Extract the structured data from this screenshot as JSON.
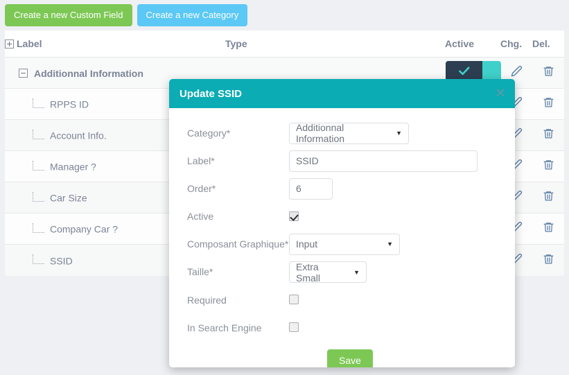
{
  "toolbar": {
    "create_custom_field_label": "Create a new Custom Field",
    "create_category_label": "Create a new Category"
  },
  "table": {
    "columns": {
      "label": "Label",
      "type": "Type",
      "active": "Active",
      "chg": "Chg.",
      "del": "Del."
    },
    "expand_all_icon": "plus-square-icon",
    "category": {
      "name": "Additionnal Information",
      "collapse_icon": "minus-square-icon",
      "active": true
    },
    "rows": [
      {
        "label": "RPPS ID",
        "type": ""
      },
      {
        "label": "Account Info.",
        "type": ""
      },
      {
        "label": "Manager ?",
        "type": ""
      },
      {
        "label": "Car Size",
        "type": ""
      },
      {
        "label": "Company Car ?",
        "type": ""
      },
      {
        "label": "SSID",
        "type": ""
      }
    ],
    "edit_icon": "pencil-icon",
    "delete_icon": "trash-icon"
  },
  "modal": {
    "title": "Update SSID",
    "close_icon": "close-icon",
    "fields": {
      "category_label": "Category*",
      "category_value": "Additionnal Information",
      "label_label": "Label*",
      "label_value": "SSID",
      "order_label": "Order*",
      "order_value": "6",
      "active_label": "Active",
      "active_checked": true,
      "composant_label": "Composant Graphique*",
      "composant_value": "Input",
      "taille_label": "Taille*",
      "taille_value": "Extra Small",
      "required_label": "Required",
      "required_checked": false,
      "search_engine_label": "In Search Engine",
      "search_engine_checked": false
    },
    "save_label": "Save",
    "dropdown_arrow": "▼"
  },
  "colors": {
    "green": "#7dc855",
    "blue": "#5bc8f5",
    "teal": "#0bacb4",
    "toggle_on": "#3fd0c9",
    "toggle_knob": "#2c3e50",
    "page_bg": "#eef0f4"
  }
}
